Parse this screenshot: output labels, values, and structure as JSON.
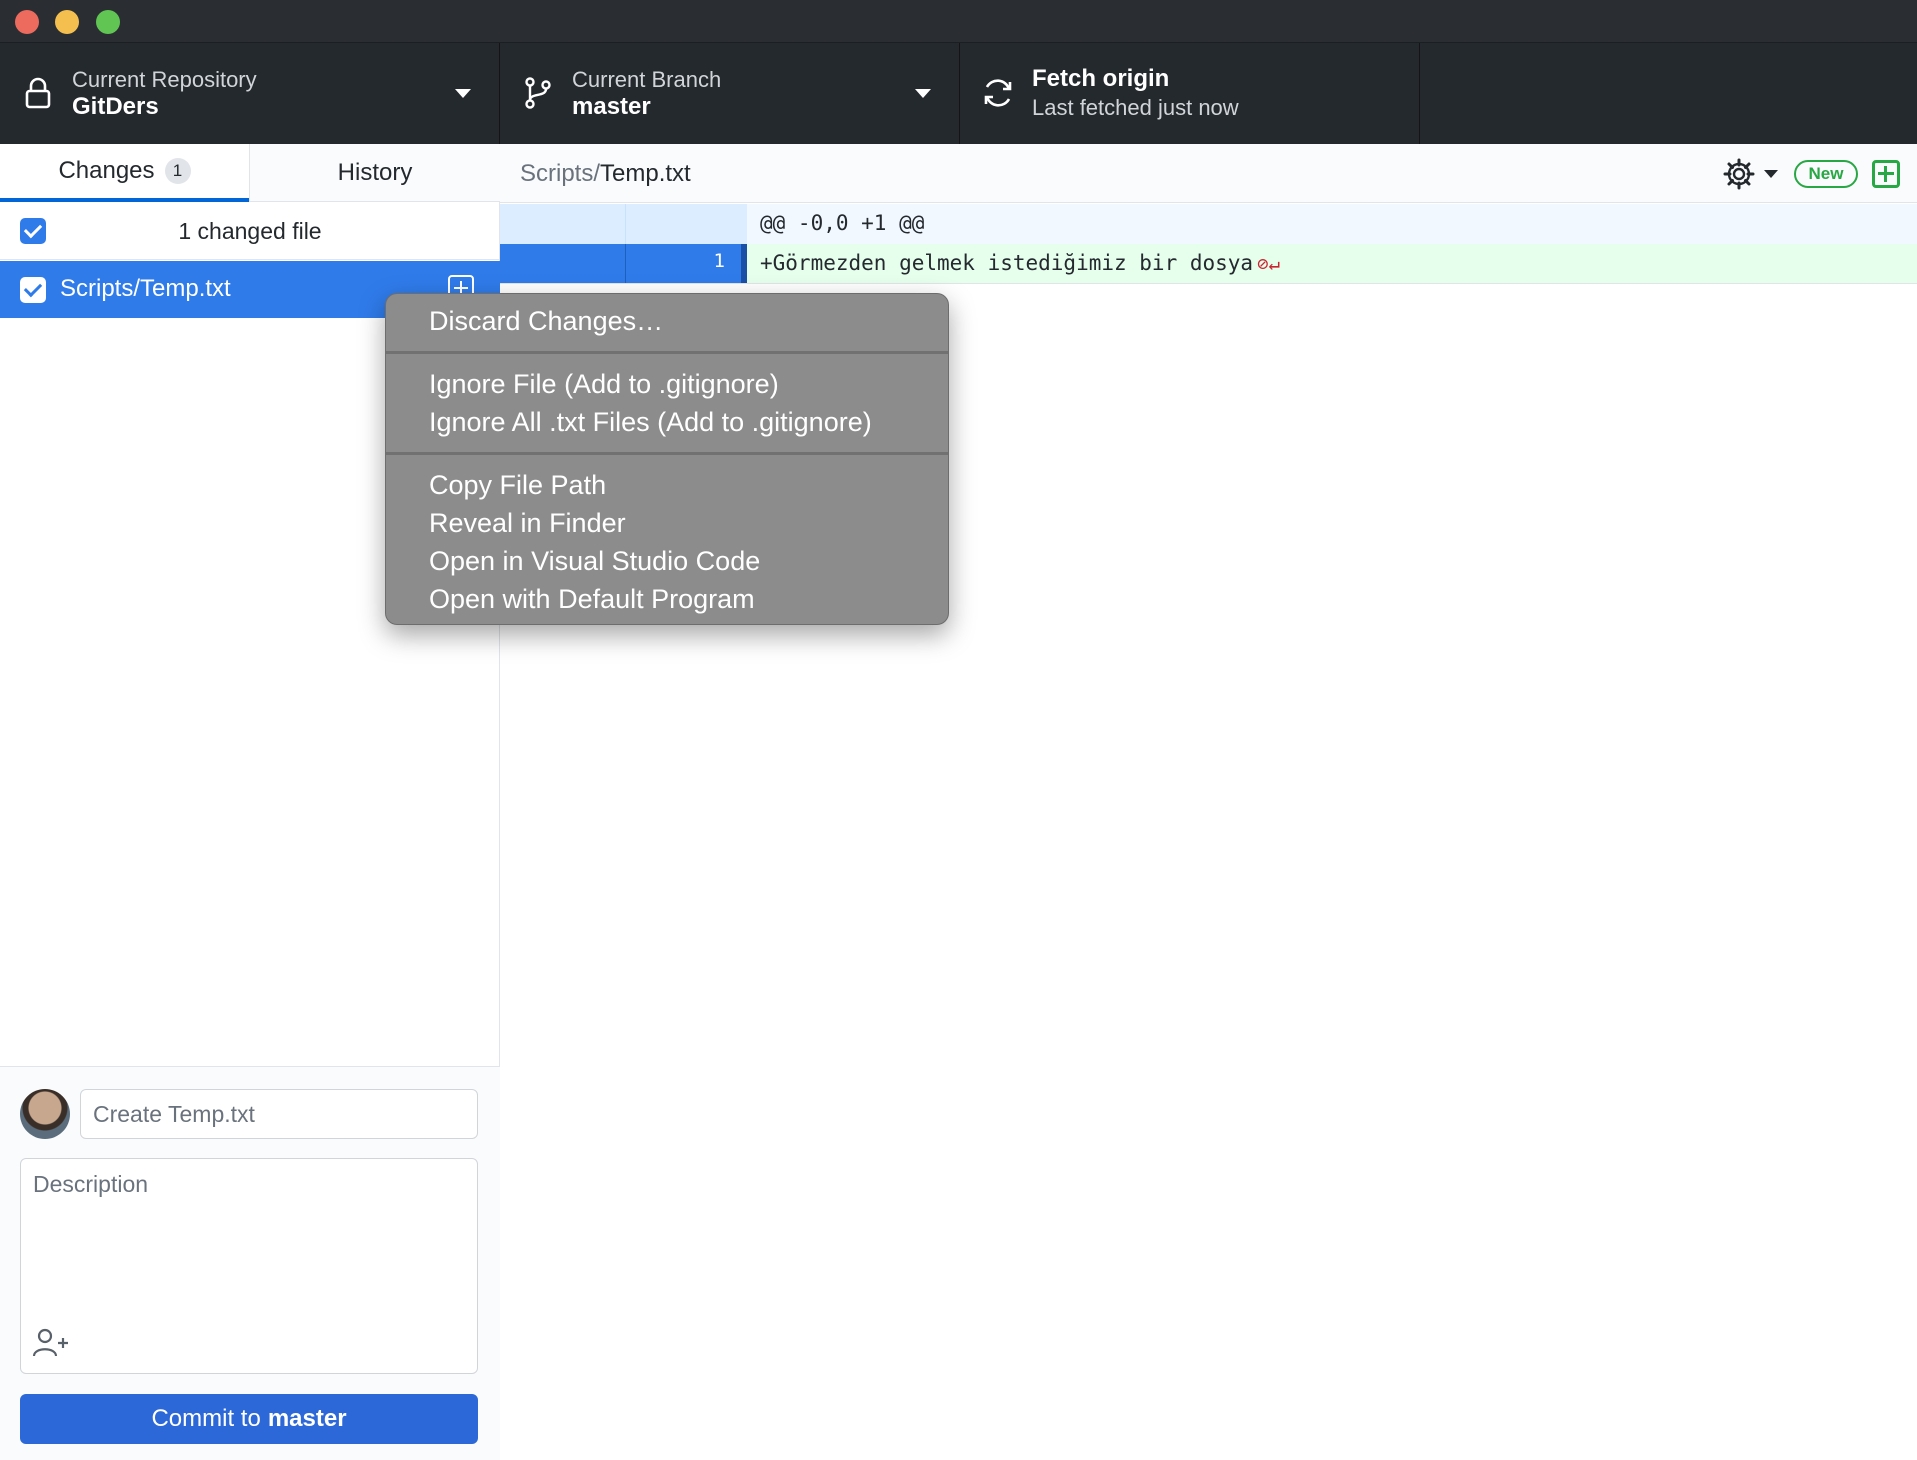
{
  "toolbar": {
    "repository": {
      "label": "Current Repository",
      "value": "GitDers"
    },
    "branch": {
      "label": "Current Branch",
      "value": "master"
    },
    "fetch": {
      "label": "Fetch origin",
      "value": "Last fetched just now"
    }
  },
  "sidebar": {
    "tabs": [
      {
        "label": "Changes",
        "count": "1"
      },
      {
        "label": "History"
      }
    ],
    "changed_count": "1 changed file",
    "files": [
      {
        "name": "Scripts/Temp.txt",
        "checked": true,
        "status": "added"
      }
    ]
  },
  "commit": {
    "summary_placeholder": "Create Temp.txt",
    "description_placeholder": "Description",
    "button_prefix": "Commit to",
    "button_branch": "master"
  },
  "diff": {
    "path_dir": "Scripts/",
    "path_file": "Temp.txt",
    "new_badge": "New",
    "hunk_header": "@@ -0,0 +1 @@",
    "lines": [
      {
        "number": "1",
        "text": "+Görmezden gelmek istediğimiz bir dosya",
        "marker": "⊘↵"
      }
    ]
  },
  "context_menu": {
    "items": [
      "Discard Changes…",
      "Ignore File (Add to .gitignore)",
      "Ignore All .txt Files (Add to .gitignore)",
      "Copy File Path",
      "Reveal in Finder",
      "Open in Visual Studio Code",
      "Open with Default Program"
    ]
  },
  "colors": {
    "accent": "#2f7bea",
    "toolbar_bg": "#24292e",
    "diff_add_bg": "#e6ffed",
    "new_green": "#28a745"
  },
  "icons": {
    "repo": "lock-icon",
    "branch": "git-branch-icon",
    "fetch": "sync-icon",
    "settings": "gear-icon",
    "coauthor": "person-add-icon"
  }
}
